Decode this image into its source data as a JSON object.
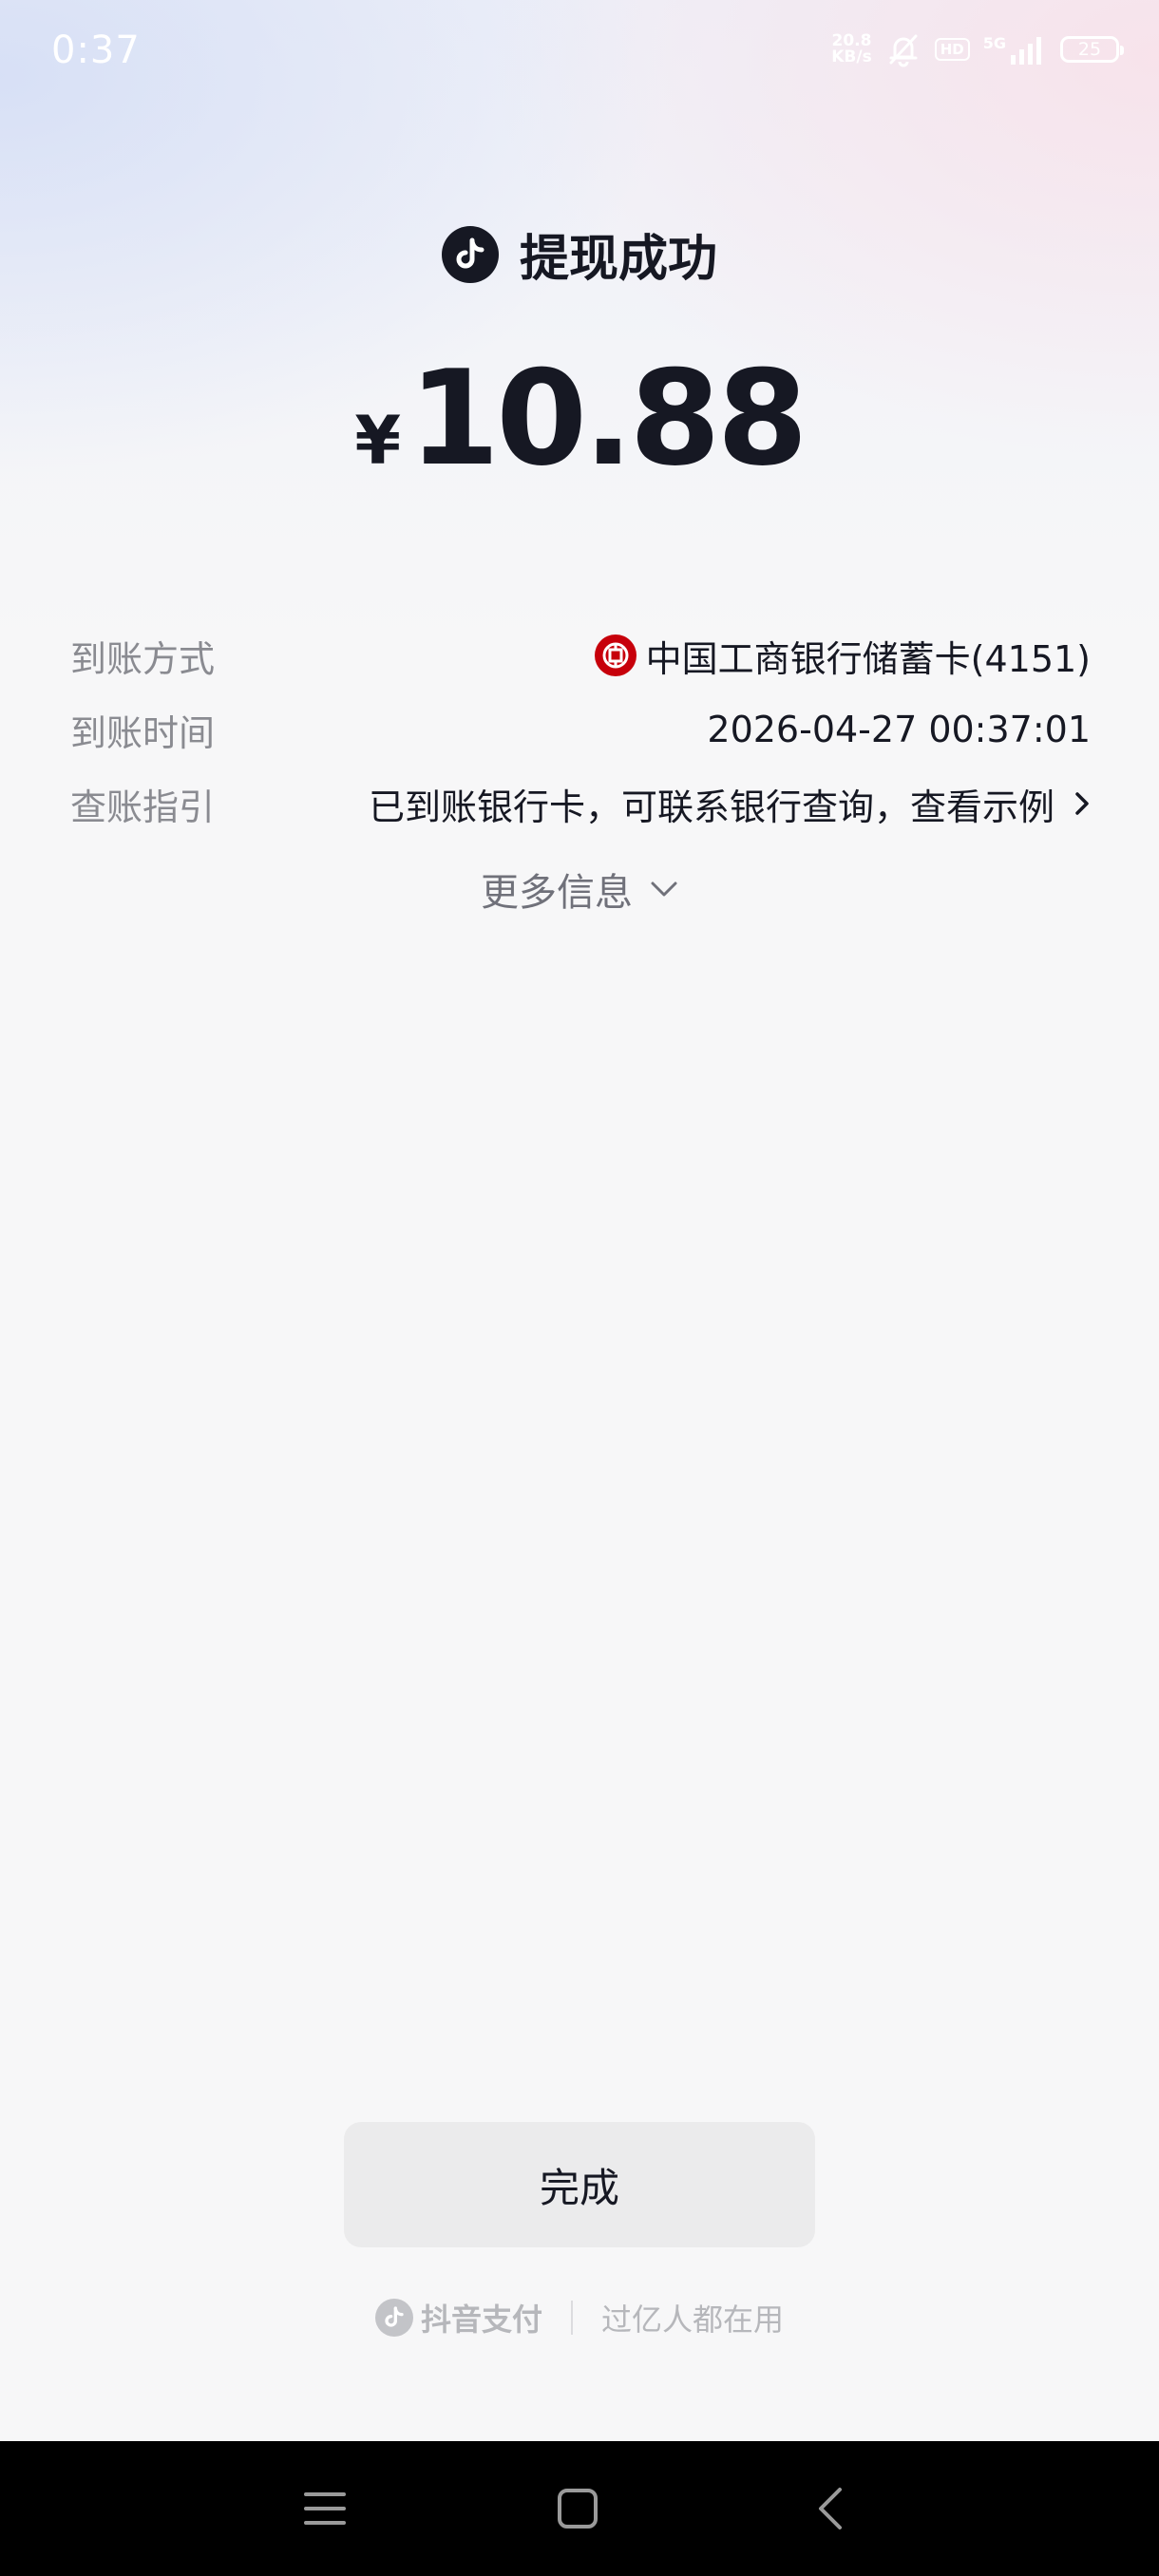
{
  "status_bar": {
    "time": "0:37",
    "net_speed_value": "20.8",
    "net_speed_unit": "KB/s",
    "hd_label": "HD",
    "network": "5G",
    "battery": "25",
    "icons": [
      "mute-bell-icon",
      "signal-icon",
      "battery-icon"
    ]
  },
  "header": {
    "title": "提现成功",
    "currency": "¥",
    "amount": "10.88",
    "logo_icon": "douyin-logo-icon"
  },
  "details": {
    "rows": [
      {
        "label": "到账方式",
        "value": "中国工商银行储蓄卡(4151)",
        "icon": "icbc-bank-icon"
      },
      {
        "label": "到账时间",
        "value": "2026-04-27 00:37:01"
      },
      {
        "label": "查账指引",
        "value": "已到账银行卡，可联系银行查询，查看示例",
        "icon": "chevron-right-icon"
      }
    ],
    "more_info_label": "更多信息"
  },
  "actions": {
    "done_label": "完成"
  },
  "footer": {
    "brand": "抖音支付",
    "tagline": "过亿人都在用"
  },
  "colors": {
    "text_primary": "#161823",
    "text_secondary": "#8a8b91",
    "button_bg": "#ebebec",
    "bank_red": "#c7000b",
    "nav_bar": "#000000"
  }
}
